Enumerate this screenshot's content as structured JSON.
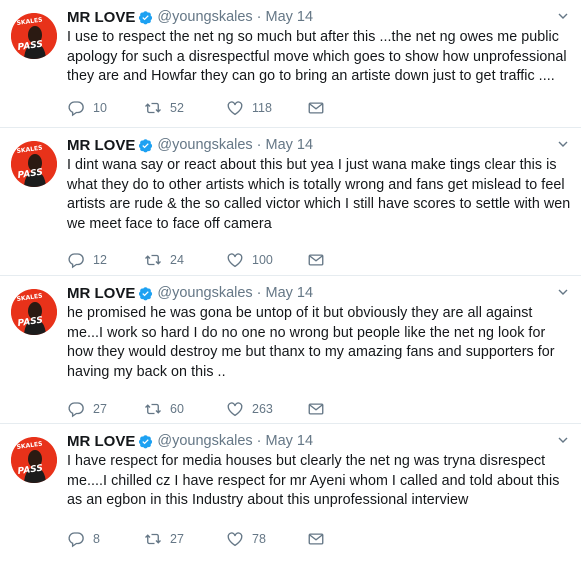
{
  "tweets": [
    {
      "name": "MR LOVE",
      "handle": "@youngskales",
      "separator": "·",
      "date": "May 14",
      "text": "I use to respect the net ng so much but after this ...the net ng owes me public apology for such a disrespectful move which goes to show how unprofessional they are and Howfar they can go to bring an artiste down just to get traffic ....",
      "replies": "10",
      "retweets": "52",
      "likes": "118"
    },
    {
      "name": "MR LOVE",
      "handle": "@youngskales",
      "separator": "·",
      "date": "May 14",
      "text": "I dint wana say or react about this but yea I just wana make tings clear this is what they do to other artists which is totally wrong and fans get mislead to feel artists are rude & the so called victor which I still have scores to settle with wen we meet face to face off camera",
      "replies": "12",
      "retweets": "24",
      "likes": "100"
    },
    {
      "name": "MR LOVE",
      "handle": "@youngskales",
      "separator": "·",
      "date": "May 14",
      "text": "he promised he was gona be untop of it but obviously they are all against me...I work so hard I do no one no wrong but people like the net ng look for how they would destroy me but thanx to my amazing fans and supporters for having my back on this ..",
      "replies": "27",
      "retweets": "60",
      "likes": "263"
    },
    {
      "name": "MR LOVE",
      "handle": "@youngskales",
      "separator": "·",
      "date": "May 14",
      "text": "I have respect for media houses but clearly the net ng was tryna disrespect me....I chilled cz I have respect for mr Ayeni whom I called and told about this as an egbon in this Industry about this unprofessional interview",
      "replies": "8",
      "retweets": "27",
      "likes": "78"
    }
  ],
  "avatar_text": {
    "top": "SKALES",
    "bottom": "PASS"
  },
  "colors": {
    "accent": "#1da1f2",
    "avatar_bg": "#e8321a",
    "muted": "#657786",
    "divider": "#e6ecf0"
  },
  "icons": [
    "reply-icon",
    "retweet-icon",
    "like-icon",
    "direct-message-icon",
    "verified-badge-icon",
    "chevron-down-icon"
  ]
}
